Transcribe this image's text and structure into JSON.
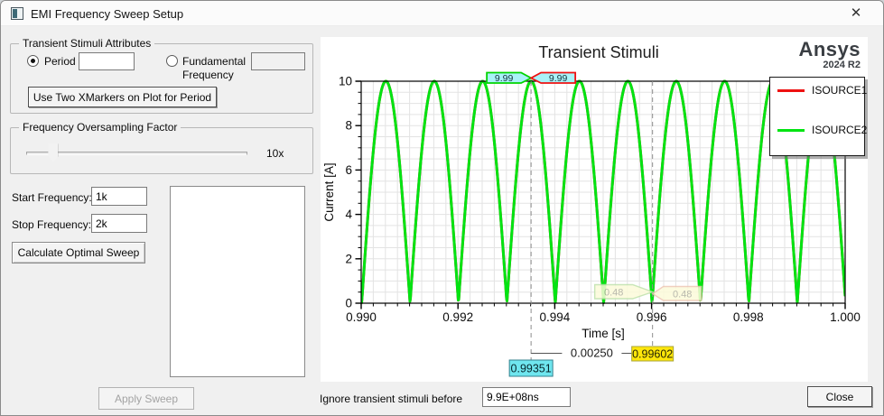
{
  "window": {
    "title": "EMI Frequency Sweep Setup",
    "close_glyph": "✕"
  },
  "left_panel": {
    "group_transient": {
      "title": "Transient Stimuli Attributes",
      "radio_period": {
        "label": "Period",
        "selected": true,
        "value": ""
      },
      "radio_fundamental": {
        "label": "Fundamental Frequency",
        "selected": false,
        "value": ""
      },
      "xmarkers_button": "Use Two XMarkers on Plot for Period"
    },
    "group_oversampling": {
      "title": "Frequency Oversampling Factor",
      "slider_percent": 12,
      "value_label": "10x"
    },
    "start_frequency": {
      "label": "Start Frequency:",
      "value": "1k"
    },
    "stop_frequency": {
      "label": "Stop Frequency:",
      "value": "2k"
    },
    "calculate_button": "Calculate Optimal Sweep",
    "apply_button": {
      "label": "Apply Sweep",
      "enabled": false
    }
  },
  "footer": {
    "ignore_label": "Ignore transient stimuli before",
    "ignore_value": "9.9E+08ns",
    "close_button": "Close"
  },
  "brand": {
    "name": "Ansys",
    "version": "2024 R2"
  },
  "chart_data": {
    "type": "line",
    "title": "Transient Stimuli",
    "xlabel": "Time [s]",
    "ylabel": "Current [A]",
    "xlim": [
      0.99,
      1.0
    ],
    "ylim": [
      0,
      10
    ],
    "x_ticks": {
      "values": [
        0.99,
        0.992,
        0.994,
        0.996,
        0.998,
        1.0
      ],
      "labels": [
        "0.990",
        "0.992",
        "0.994",
        "0.996",
        "0.998",
        "1.000"
      ]
    },
    "y_ticks": {
      "values": [
        0,
        2,
        4,
        6,
        8,
        10
      ],
      "labels": [
        "0",
        "2",
        "4",
        "6",
        "8",
        "10"
      ]
    },
    "x_minor_step": 0.00025,
    "y_minor_step": 0.5,
    "grid": true,
    "grid_color": "#e3e3e3",
    "legend_position": "top-right",
    "series": [
      {
        "name": "ISOURCE1",
        "color": "#ee1111",
        "waveform": "rectified_sine",
        "amplitude": 10,
        "hump_period": 0.001,
        "zero_crossing": 0.99001
      },
      {
        "name": "ISOURCE2",
        "color": "#00e412",
        "waveform": "rectified_sine",
        "amplitude": 10,
        "hump_period": 0.001,
        "zero_crossing": 0.99001
      }
    ],
    "markers": {
      "m1": {
        "x": 0.99351,
        "axis_label": "0.99351",
        "axis_label_fill": "#6fe6ef",
        "value_labels": [
          "9.99",
          "9.99"
        ],
        "label_fill": "#a9f2f8",
        "label_borders": [
          "#00d400",
          "#ee1111"
        ]
      },
      "m2": {
        "x": 0.99602,
        "axis_label": "0.99602",
        "axis_label_fill": "#ffe60a",
        "value_labels": [
          "0.48",
          "0.48"
        ],
        "label_fill": "#fcfbda",
        "label_borders": [
          "#bfe2ab",
          "#eec7b4"
        ]
      },
      "delta_label": "0.00250"
    }
  }
}
